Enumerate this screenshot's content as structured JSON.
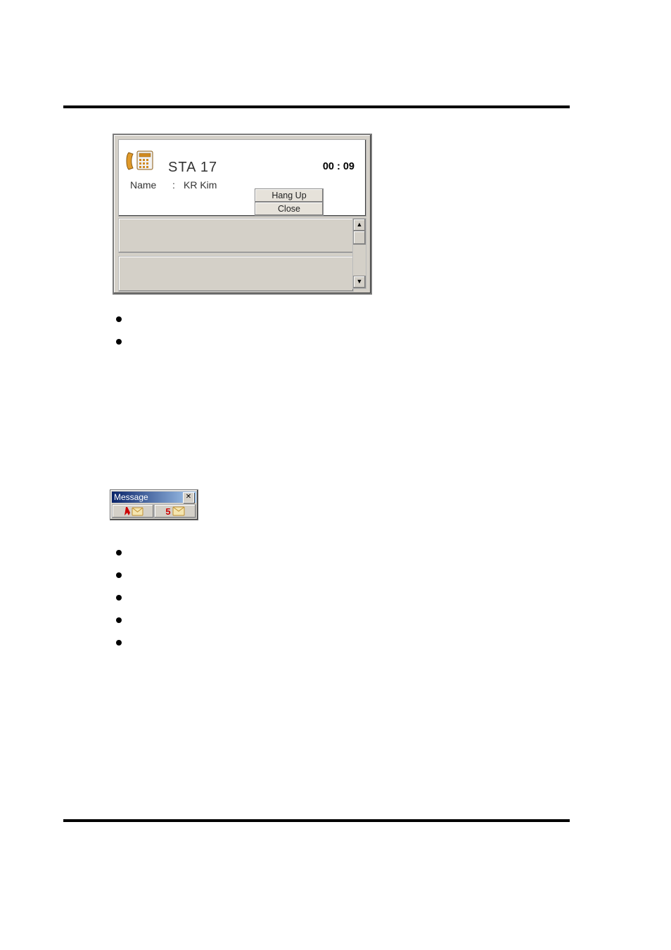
{
  "call_panel": {
    "station": "STA  17",
    "name_label": "Name",
    "name_value": "KR Kim",
    "time": "00 : 09",
    "buttons": {
      "hang_up": "Hang Up",
      "close": "Close"
    },
    "scroll": {
      "up": "▲",
      "down": "▼"
    }
  },
  "message_bar": {
    "title": "Message",
    "close": "✕",
    "left_count": "",
    "right_count": "5"
  }
}
